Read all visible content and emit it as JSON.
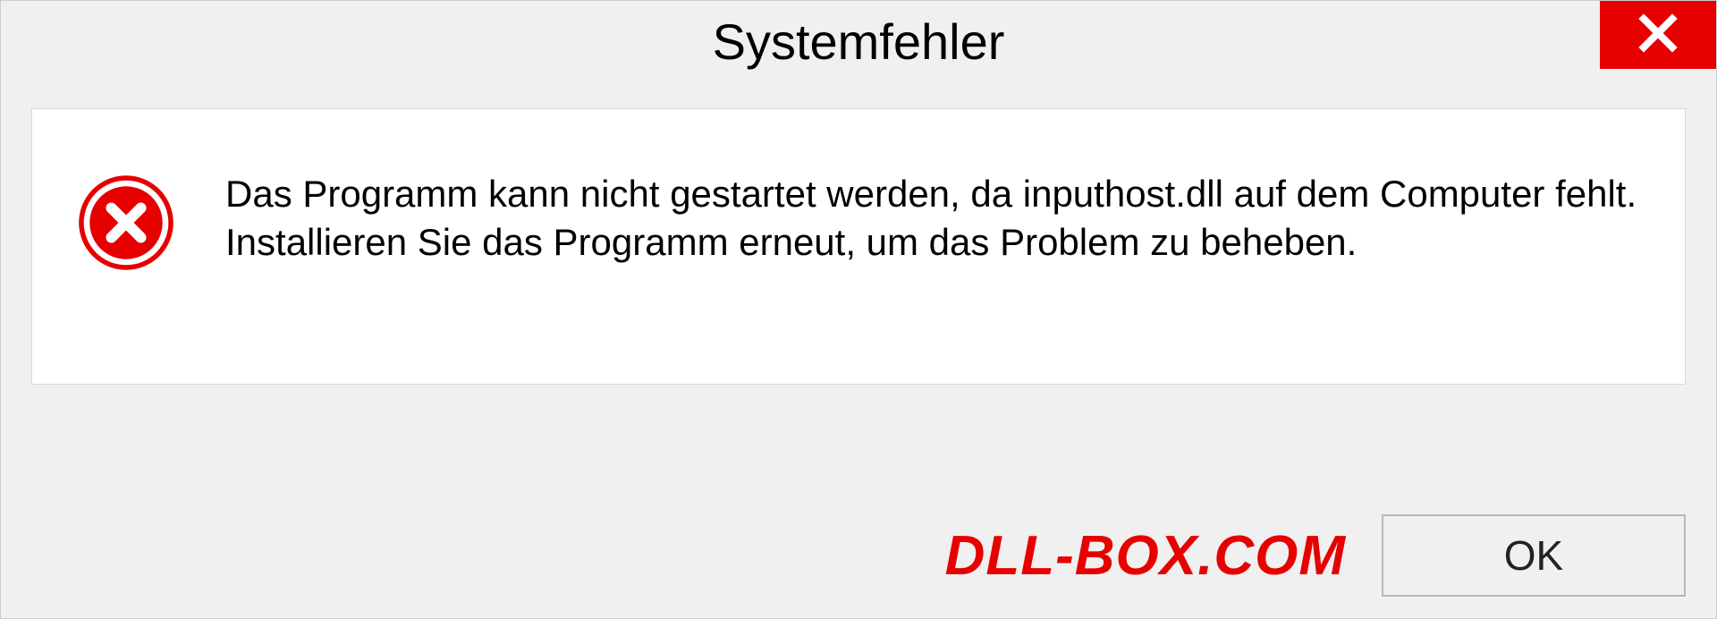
{
  "dialog": {
    "title": "Systemfehler",
    "message": "Das Programm kann nicht gestartet werden, da inputhost.dll auf dem Computer fehlt. Installieren Sie das Programm erneut, um das Problem zu beheben.",
    "ok_label": "OK",
    "watermark": "DLL-BOX.COM",
    "icons": {
      "close": "close-icon",
      "error": "error-circle-x-icon"
    },
    "colors": {
      "accent_red": "#e60000",
      "panel_bg": "#ffffff",
      "window_bg": "#f0f0f0"
    }
  }
}
